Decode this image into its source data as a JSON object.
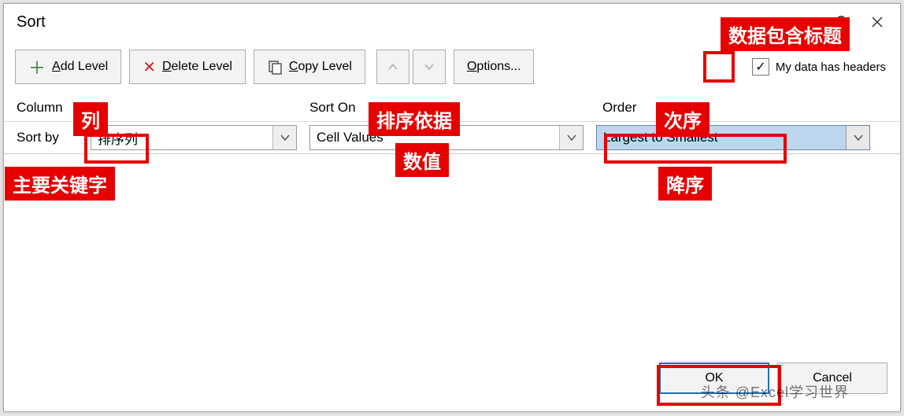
{
  "dialog": {
    "title": "Sort"
  },
  "toolbar": {
    "add_level": "Add Level",
    "delete_level": "Delete Level",
    "copy_level": "Copy Level",
    "options": "Options...",
    "headers_label": "My data has headers",
    "headers_checked": "✓"
  },
  "headers": {
    "column": "Column",
    "sort_on": "Sort On",
    "order": "Order"
  },
  "row": {
    "sort_by": "Sort by",
    "column_value": "排序列",
    "sort_on_value": "Cell Values",
    "order_value": "Largest to Smallest"
  },
  "footer": {
    "ok": "OK",
    "cancel": "Cancel"
  },
  "annotations": {
    "headers": "数据包含标题",
    "column": "列",
    "sort_on": "排序依据",
    "order": "次序",
    "primary_key": "主要关键字",
    "cell_values": "数值",
    "descending": "降序"
  },
  "watermark": "头条 @Excel学习世界"
}
